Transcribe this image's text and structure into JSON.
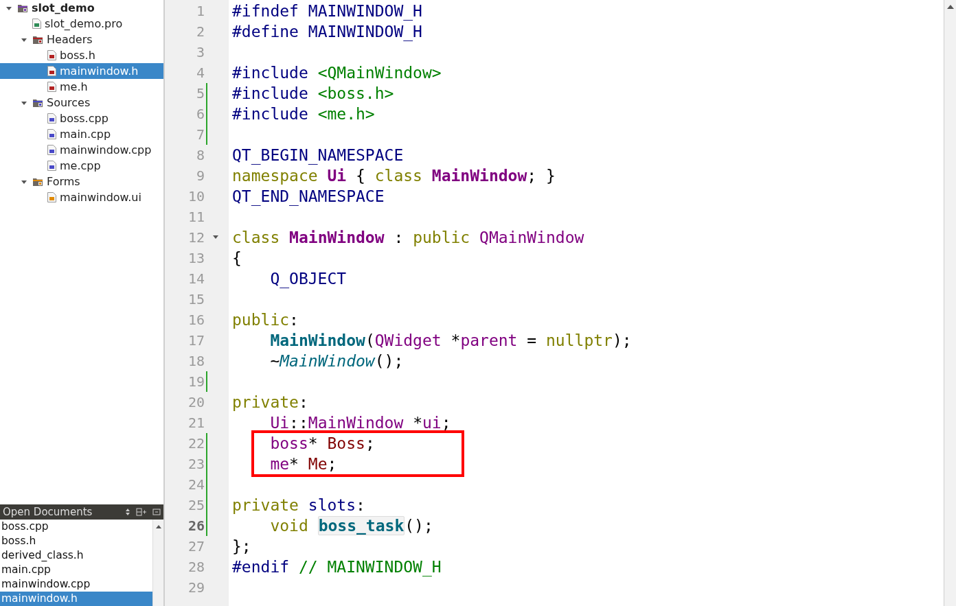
{
  "project_tree": [
    {
      "label": "slot_demo",
      "kind": "project",
      "expanded": true,
      "selected": false,
      "children": [
        {
          "label": "slot_demo.pro",
          "kind": "pro",
          "selected": false
        },
        {
          "label": "Headers",
          "kind": "header-folder",
          "expanded": true,
          "selected": false,
          "children": [
            {
              "label": "boss.h",
              "kind": "header",
              "selected": false
            },
            {
              "label": "mainwindow.h",
              "kind": "header",
              "selected": true
            },
            {
              "label": "me.h",
              "kind": "header",
              "selected": false
            }
          ]
        },
        {
          "label": "Sources",
          "kind": "source-folder",
          "expanded": true,
          "selected": false,
          "children": [
            {
              "label": "boss.cpp",
              "kind": "source",
              "selected": false
            },
            {
              "label": "main.cpp",
              "kind": "source",
              "selected": false
            },
            {
              "label": "mainwindow.cpp",
              "kind": "source",
              "selected": false
            },
            {
              "label": "me.cpp",
              "kind": "source",
              "selected": false
            }
          ]
        },
        {
          "label": "Forms",
          "kind": "form-folder",
          "expanded": true,
          "selected": false,
          "children": [
            {
              "label": "mainwindow.ui",
              "kind": "form",
              "selected": false
            }
          ]
        }
      ]
    }
  ],
  "open_documents": {
    "title": "Open Documents",
    "items": [
      {
        "label": "boss.cpp",
        "selected": false
      },
      {
        "label": "boss.h",
        "selected": false
      },
      {
        "label": "derived_class.h",
        "selected": false
      },
      {
        "label": "main.cpp",
        "selected": false
      },
      {
        "label": "mainwindow.cpp",
        "selected": false
      },
      {
        "label": "mainwindow.h",
        "selected": true
      }
    ]
  },
  "editor": {
    "lines": [
      {
        "number": "1",
        "tokens": [
          {
            "text": "#ifndef ",
            "kind": "pre"
          },
          {
            "text": "MAINWINDOW_H",
            "kind": "macro"
          }
        ]
      },
      {
        "number": "2",
        "tokens": [
          {
            "text": "#define ",
            "kind": "pre"
          },
          {
            "text": "MAINWINDOW_H",
            "kind": "macro"
          }
        ]
      },
      {
        "number": "3"
      },
      {
        "number": "4",
        "tokens": [
          {
            "text": "#include ",
            "kind": "pre"
          },
          {
            "text": "<QMainWindow>",
            "kind": "str"
          }
        ]
      },
      {
        "number": "5",
        "modified": true,
        "tokens": [
          {
            "text": "#include ",
            "kind": "pre"
          },
          {
            "text": "<boss.h>",
            "kind": "str"
          }
        ]
      },
      {
        "number": "6",
        "modified": true,
        "tokens": [
          {
            "text": "#include ",
            "kind": "pre"
          },
          {
            "text": "<me.h>",
            "kind": "str"
          }
        ]
      },
      {
        "number": "7",
        "modified": true
      },
      {
        "number": "8",
        "tokens": [
          {
            "text": "QT_BEGIN_NAMESPACE",
            "kind": "macro"
          }
        ]
      },
      {
        "number": "9",
        "tokens": [
          {
            "text": "namespace ",
            "kind": "kw"
          },
          {
            "text": "Ui",
            "kind": "cls"
          },
          {
            "text": " { ",
            "kind": "plain"
          },
          {
            "text": "class ",
            "kind": "kw"
          },
          {
            "text": "MainWindow",
            "kind": "cls"
          },
          {
            "text": "; }",
            "kind": "plain"
          }
        ]
      },
      {
        "number": "10",
        "tokens": [
          {
            "text": "QT_END_NAMESPACE",
            "kind": "macro"
          }
        ]
      },
      {
        "number": "11"
      },
      {
        "number": "12",
        "foldable": true,
        "tokens": [
          {
            "text": "class ",
            "kind": "kw"
          },
          {
            "text": "MainWindow",
            "kind": "cls"
          },
          {
            "text": " : ",
            "kind": "plain"
          },
          {
            "text": "public ",
            "kind": "kw"
          },
          {
            "text": "QMainWindow",
            "kind": "type"
          }
        ]
      },
      {
        "number": "13",
        "tokens": [
          {
            "text": "{",
            "kind": "plain"
          }
        ]
      },
      {
        "number": "14",
        "tokens": [
          {
            "text": "    Q_OBJECT",
            "kind": "macro"
          }
        ]
      },
      {
        "number": "15"
      },
      {
        "number": "16",
        "tokens": [
          {
            "text": "public",
            "kind": "kw"
          },
          {
            "text": ":",
            "kind": "plain"
          }
        ]
      },
      {
        "number": "17",
        "tokens": [
          {
            "text": "    MainWindow",
            "kind": "fn"
          },
          {
            "text": "(",
            "kind": "plain"
          },
          {
            "text": "QWidget",
            "kind": "type"
          },
          {
            "text": " *",
            "kind": "plain"
          },
          {
            "text": "parent",
            "kind": "type"
          },
          {
            "text": " = ",
            "kind": "plain"
          },
          {
            "text": "nullptr",
            "kind": "kw"
          },
          {
            "text": ");",
            "kind": "plain"
          }
        ]
      },
      {
        "number": "18",
        "tokens": [
          {
            "text": "    ~",
            "kind": "plain"
          },
          {
            "text": "MainWindow",
            "kind": "virt"
          },
          {
            "text": "();",
            "kind": "plain"
          }
        ]
      },
      {
        "number": "19",
        "modified": true
      },
      {
        "number": "20",
        "tokens": [
          {
            "text": "private",
            "kind": "kw"
          },
          {
            "text": ":",
            "kind": "plain"
          }
        ]
      },
      {
        "number": "21",
        "tokens": [
          {
            "text": "    Ui",
            "kind": "type"
          },
          {
            "text": "::",
            "kind": "plain"
          },
          {
            "text": "MainWindow",
            "kind": "type"
          },
          {
            "text": " *",
            "kind": "plain"
          },
          {
            "text": "ui",
            "kind": "type"
          },
          {
            "text": ";",
            "kind": "plain"
          }
        ]
      },
      {
        "number": "22",
        "modified": true,
        "boxed": true,
        "tokens": [
          {
            "text": "    boss",
            "kind": "type"
          },
          {
            "text": "* ",
            "kind": "plain"
          },
          {
            "text": "Boss",
            "kind": "field"
          },
          {
            "text": ";",
            "kind": "plain"
          }
        ]
      },
      {
        "number": "23",
        "modified": true,
        "boxed": true,
        "tokens": [
          {
            "text": "    me",
            "kind": "type"
          },
          {
            "text": "* ",
            "kind": "plain"
          },
          {
            "text": "Me",
            "kind": "field"
          },
          {
            "text": ";",
            "kind": "plain"
          }
        ]
      },
      {
        "number": "24",
        "modified": true
      },
      {
        "number": "25",
        "modified": true,
        "tokens": [
          {
            "text": "private ",
            "kind": "kw"
          },
          {
            "text": "slots",
            "kind": "macro"
          },
          {
            "text": ":",
            "kind": "plain"
          }
        ]
      },
      {
        "number": "26",
        "modified": true,
        "current": true,
        "tokens": [
          {
            "text": "    void ",
            "kind": "kw"
          },
          {
            "text": "boss_task",
            "kind": "fn-hl"
          },
          {
            "text": "();",
            "kind": "plain"
          }
        ]
      },
      {
        "number": "27",
        "tokens": [
          {
            "text": "};",
            "kind": "plain"
          }
        ]
      },
      {
        "number": "28",
        "tokens": [
          {
            "text": "#endif ",
            "kind": "pre"
          },
          {
            "text": "// MAINWINDOW_H",
            "kind": "comment"
          }
        ]
      },
      {
        "number": "29"
      }
    ]
  }
}
